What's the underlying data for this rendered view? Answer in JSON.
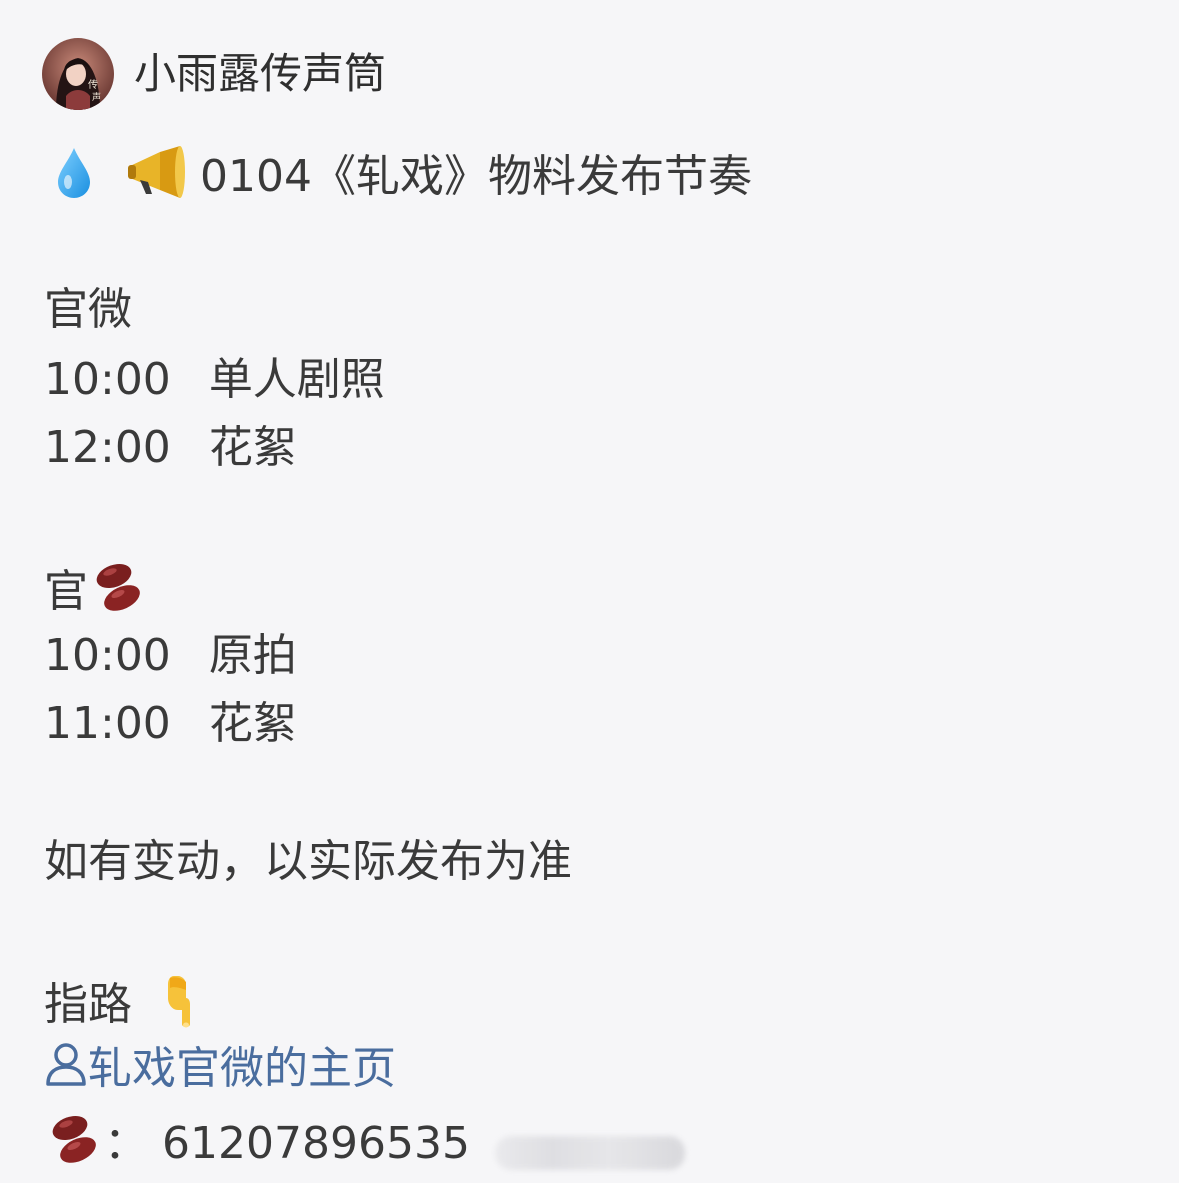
{
  "post": {
    "author": "小雨露传声筒",
    "title_text": "0104《轧戏》物料发布节奏",
    "section1": {
      "heading": "官微",
      "items": [
        {
          "time": "10:00",
          "label": "单人剧照"
        },
        {
          "time": "12:00",
          "label": "花絮"
        }
      ]
    },
    "section2": {
      "heading": "官",
      "items": [
        {
          "time": "10:00",
          "label": "原拍"
        },
        {
          "time": "11:00",
          "label": "花絮"
        }
      ]
    },
    "notice": "如有变动，以实际发布为准",
    "guide_label": "指路",
    "profile_link": "轧戏官微的主页",
    "bean_colon": "：",
    "bean_id": "61207896535"
  },
  "icons": {
    "avatar": "avatar-photo",
    "droplet": "droplet-icon",
    "megaphone": "megaphone-icon",
    "beans": "beans-icon",
    "pointing_down": "pointing-down-icon",
    "person": "person-icon"
  },
  "colors": {
    "background": "#f6f6f8",
    "text": "#3a3a3a",
    "link": "#4a6d9e"
  }
}
